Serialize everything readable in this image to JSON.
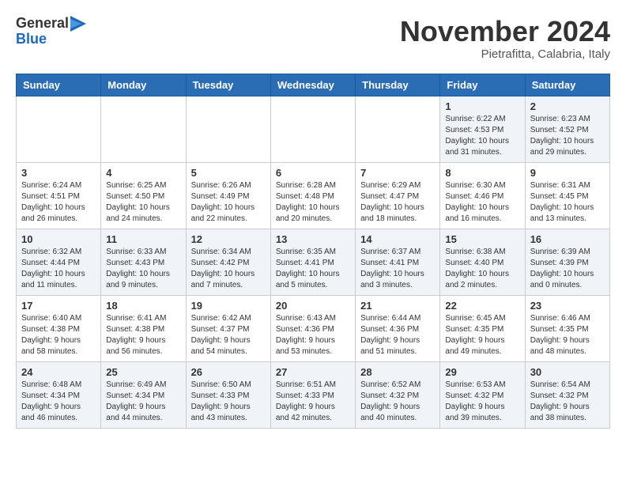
{
  "logo": {
    "general": "General",
    "blue": "Blue"
  },
  "title": "November 2024",
  "location": "Pietrafitta, Calabria, Italy",
  "days_of_week": [
    "Sunday",
    "Monday",
    "Tuesday",
    "Wednesday",
    "Thursday",
    "Friday",
    "Saturday"
  ],
  "weeks": [
    [
      {
        "day": "",
        "info": ""
      },
      {
        "day": "",
        "info": ""
      },
      {
        "day": "",
        "info": ""
      },
      {
        "day": "",
        "info": ""
      },
      {
        "day": "",
        "info": ""
      },
      {
        "day": "1",
        "info": "Sunrise: 6:22 AM\nSunset: 4:53 PM\nDaylight: 10 hours\nand 31 minutes."
      },
      {
        "day": "2",
        "info": "Sunrise: 6:23 AM\nSunset: 4:52 PM\nDaylight: 10 hours\nand 29 minutes."
      }
    ],
    [
      {
        "day": "3",
        "info": "Sunrise: 6:24 AM\nSunset: 4:51 PM\nDaylight: 10 hours\nand 26 minutes."
      },
      {
        "day": "4",
        "info": "Sunrise: 6:25 AM\nSunset: 4:50 PM\nDaylight: 10 hours\nand 24 minutes."
      },
      {
        "day": "5",
        "info": "Sunrise: 6:26 AM\nSunset: 4:49 PM\nDaylight: 10 hours\nand 22 minutes."
      },
      {
        "day": "6",
        "info": "Sunrise: 6:28 AM\nSunset: 4:48 PM\nDaylight: 10 hours\nand 20 minutes."
      },
      {
        "day": "7",
        "info": "Sunrise: 6:29 AM\nSunset: 4:47 PM\nDaylight: 10 hours\nand 18 minutes."
      },
      {
        "day": "8",
        "info": "Sunrise: 6:30 AM\nSunset: 4:46 PM\nDaylight: 10 hours\nand 16 minutes."
      },
      {
        "day": "9",
        "info": "Sunrise: 6:31 AM\nSunset: 4:45 PM\nDaylight: 10 hours\nand 13 minutes."
      }
    ],
    [
      {
        "day": "10",
        "info": "Sunrise: 6:32 AM\nSunset: 4:44 PM\nDaylight: 10 hours\nand 11 minutes."
      },
      {
        "day": "11",
        "info": "Sunrise: 6:33 AM\nSunset: 4:43 PM\nDaylight: 10 hours\nand 9 minutes."
      },
      {
        "day": "12",
        "info": "Sunrise: 6:34 AM\nSunset: 4:42 PM\nDaylight: 10 hours\nand 7 minutes."
      },
      {
        "day": "13",
        "info": "Sunrise: 6:35 AM\nSunset: 4:41 PM\nDaylight: 10 hours\nand 5 minutes."
      },
      {
        "day": "14",
        "info": "Sunrise: 6:37 AM\nSunset: 4:41 PM\nDaylight: 10 hours\nand 3 minutes."
      },
      {
        "day": "15",
        "info": "Sunrise: 6:38 AM\nSunset: 4:40 PM\nDaylight: 10 hours\nand 2 minutes."
      },
      {
        "day": "16",
        "info": "Sunrise: 6:39 AM\nSunset: 4:39 PM\nDaylight: 10 hours\nand 0 minutes."
      }
    ],
    [
      {
        "day": "17",
        "info": "Sunrise: 6:40 AM\nSunset: 4:38 PM\nDaylight: 9 hours\nand 58 minutes."
      },
      {
        "day": "18",
        "info": "Sunrise: 6:41 AM\nSunset: 4:38 PM\nDaylight: 9 hours\nand 56 minutes."
      },
      {
        "day": "19",
        "info": "Sunrise: 6:42 AM\nSunset: 4:37 PM\nDaylight: 9 hours\nand 54 minutes."
      },
      {
        "day": "20",
        "info": "Sunrise: 6:43 AM\nSunset: 4:36 PM\nDaylight: 9 hours\nand 53 minutes."
      },
      {
        "day": "21",
        "info": "Sunrise: 6:44 AM\nSunset: 4:36 PM\nDaylight: 9 hours\nand 51 minutes."
      },
      {
        "day": "22",
        "info": "Sunrise: 6:45 AM\nSunset: 4:35 PM\nDaylight: 9 hours\nand 49 minutes."
      },
      {
        "day": "23",
        "info": "Sunrise: 6:46 AM\nSunset: 4:35 PM\nDaylight: 9 hours\nand 48 minutes."
      }
    ],
    [
      {
        "day": "24",
        "info": "Sunrise: 6:48 AM\nSunset: 4:34 PM\nDaylight: 9 hours\nand 46 minutes."
      },
      {
        "day": "25",
        "info": "Sunrise: 6:49 AM\nSunset: 4:34 PM\nDaylight: 9 hours\nand 44 minutes."
      },
      {
        "day": "26",
        "info": "Sunrise: 6:50 AM\nSunset: 4:33 PM\nDaylight: 9 hours\nand 43 minutes."
      },
      {
        "day": "27",
        "info": "Sunrise: 6:51 AM\nSunset: 4:33 PM\nDaylight: 9 hours\nand 42 minutes."
      },
      {
        "day": "28",
        "info": "Sunrise: 6:52 AM\nSunset: 4:32 PM\nDaylight: 9 hours\nand 40 minutes."
      },
      {
        "day": "29",
        "info": "Sunrise: 6:53 AM\nSunset: 4:32 PM\nDaylight: 9 hours\nand 39 minutes."
      },
      {
        "day": "30",
        "info": "Sunrise: 6:54 AM\nSunset: 4:32 PM\nDaylight: 9 hours\nand 38 minutes."
      }
    ]
  ]
}
